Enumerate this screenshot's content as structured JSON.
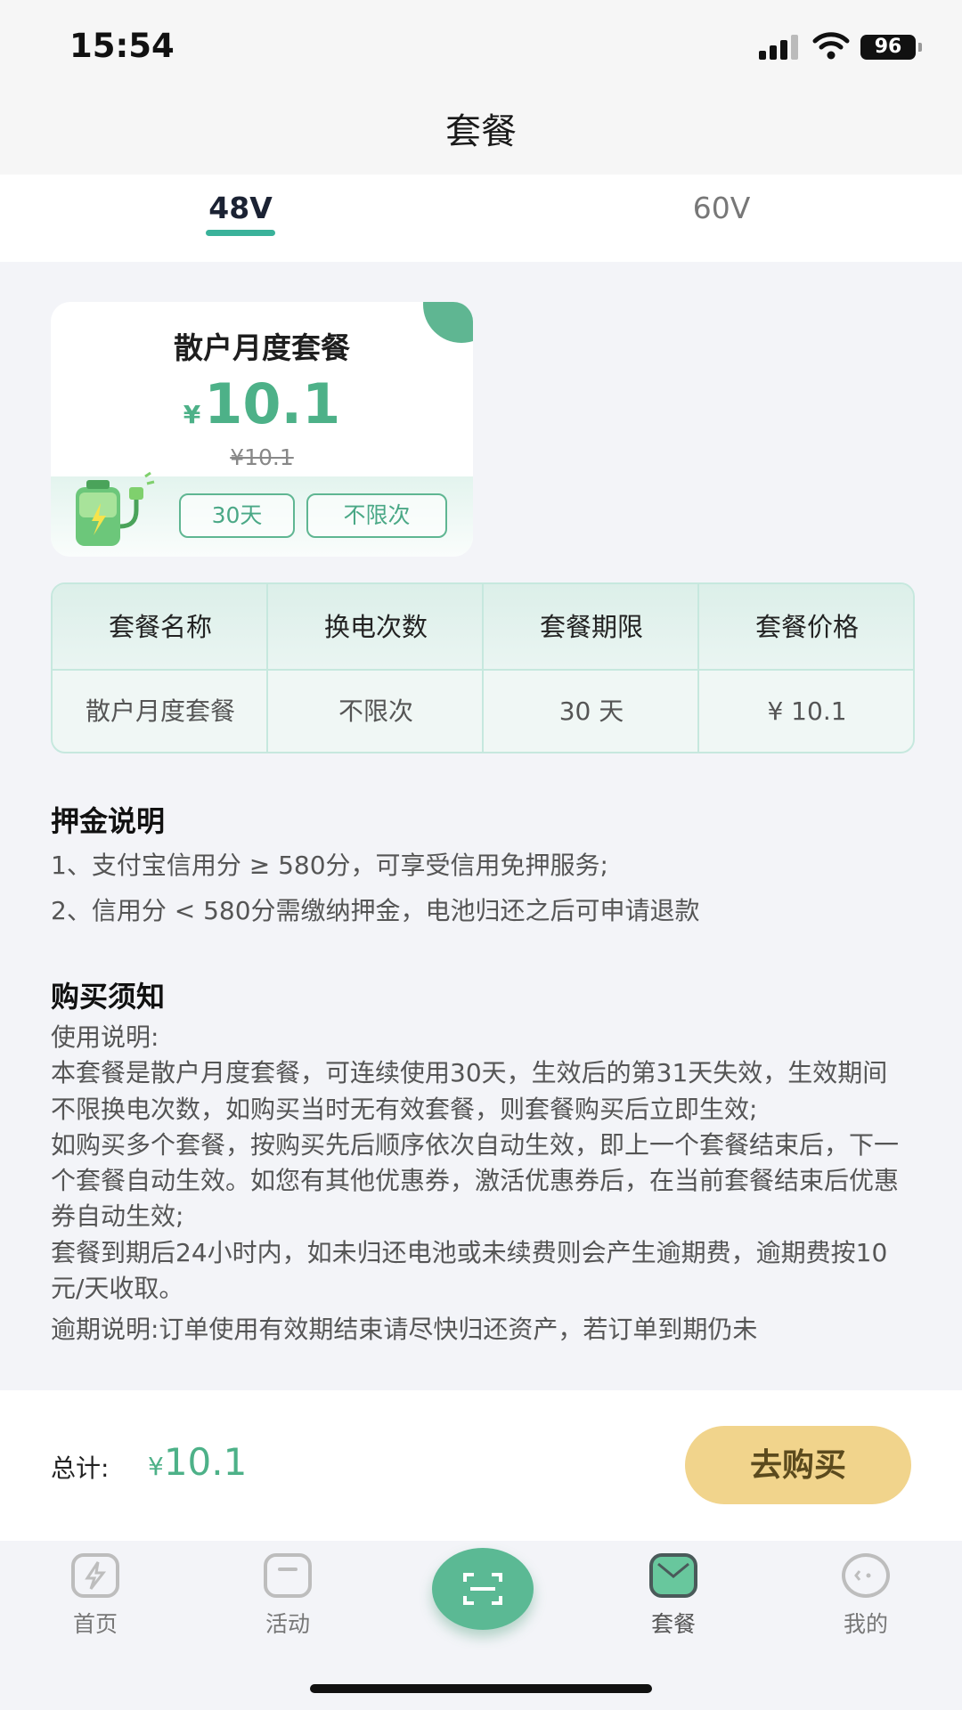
{
  "status_bar": {
    "time": "15:54",
    "battery": "96"
  },
  "header": {
    "title": "套餐"
  },
  "tabs": [
    {
      "label": "48V",
      "active": true
    },
    {
      "label": "60V",
      "active": false
    }
  ],
  "package_card": {
    "title": "散户月度套餐",
    "currency": "¥",
    "price": "10.1",
    "original_price": "¥10.1",
    "tags": [
      "30天",
      "不限次"
    ],
    "selected": true
  },
  "table": {
    "headers": [
      "套餐名称",
      "换电次数",
      "套餐期限",
      "套餐价格"
    ],
    "rows": [
      [
        "散户月度套餐",
        "不限次",
        "30 天",
        "¥  10.1"
      ]
    ]
  },
  "deposit": {
    "title": "押金说明",
    "lines": [
      "1、支付宝信用分 ≥ 580分，可享受信用免押服务;",
      "2、信用分 < 580分需缴纳押金，电池归还之后可申请退款"
    ]
  },
  "purchase": {
    "title": "购买须知",
    "lines": [
      "使用说明:",
      "本套餐是散户月度套餐，可连续使用30天，生效后的第31天失效，生效期间不限换电次数，如购买当时无有效套餐，则套餐购买后立即生效;",
      "如购买多个套餐，按购买先后顺序依次自动生效，即上一个套餐结束后，下一个套餐自动生效。如您有其他优惠券，激活优惠券后，在当前套餐结束后优惠券自动生效;",
      "套餐到期后24小时内，如未归还电池或未续费则会产生逾期费，逾期费按10元/天收取。",
      "逾期说明:订单使用有效期结束请尽快归还资产，若订单到期仍未"
    ]
  },
  "footer": {
    "total_label": "总计:",
    "currency": "¥",
    "total": "10.1",
    "buy_label": "去购买"
  },
  "tabbar": {
    "items": [
      {
        "label": "首页",
        "icon": "bolt-icon"
      },
      {
        "label": "活动",
        "icon": "activity-icon"
      },
      {
        "label": "",
        "icon": "scan-icon"
      },
      {
        "label": "套餐",
        "icon": "package-icon",
        "active": true
      },
      {
        "label": "我的",
        "icon": "profile-icon"
      }
    ]
  },
  "colors": {
    "accent": "#4db188",
    "buy_button": "#f1d48c",
    "tab_indicator": "#3ab29a"
  }
}
